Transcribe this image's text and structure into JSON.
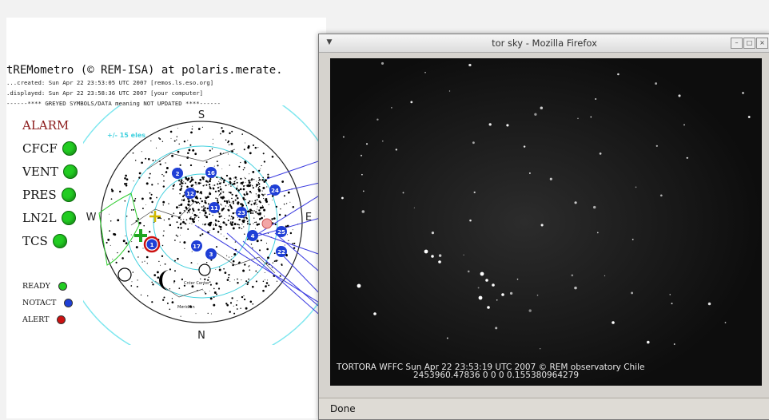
{
  "page": {
    "title": "tREMometro (© REM-ISA) at polaris.merate.",
    "info_lines": [
      "...created: Sun Apr 22 23:53:05 UTC 2007 [remos.ls.eso.org]",
      ".displayed: Sun Apr 22 23:58:36 UTC 2007 [your computer]",
      "------**** GREYED SYMBOLS/DATA meaning NOT UPDATED ****------"
    ],
    "alarm_label": "ALARM",
    "status_items": [
      {
        "label": "CFCF",
        "color": "#22cc22"
      },
      {
        "label": "VENT",
        "color": "#22cc22"
      },
      {
        "label": "PRES",
        "color": "#22cc22"
      },
      {
        "label": "LN2L",
        "color": "#22cc22"
      },
      {
        "label": "TCS",
        "color": "#22cc22"
      }
    ],
    "legend": [
      {
        "label": "READY",
        "color": "#22cc22"
      },
      {
        "label": "NOTACT",
        "color": "#1f3fd6"
      },
      {
        "label": "ALERT",
        "color": "#cc1111"
      }
    ]
  },
  "skymap": {
    "directions": {
      "north": "N",
      "south": "S",
      "east": "E",
      "west": "W"
    },
    "elevation_label": "+/- 15 eles",
    "target_markers": [
      "2",
      "16",
      "12",
      "24",
      "11",
      "23",
      "4",
      "25",
      "1",
      "17",
      "3",
      "22"
    ],
    "moon_labels": [
      "Cnter Center",
      "Meridian"
    ]
  },
  "browser": {
    "window_title": "tor sky - Mozilla Firefox",
    "menu_icon": "chevron-down-icon",
    "window_buttons": [
      "minimize-icon",
      "maximize-icon",
      "close-icon"
    ],
    "caption_line1": "TORTORA WFFC Sun Apr 22 23:53:19 UTC 2007 © REM observatory Chile",
    "caption_line2": "2453960.47836 0 0 0 0.155380964279",
    "status": "Done"
  },
  "colors": {
    "status_ok": "#22cc22",
    "marker_blue": "#1f3fd6",
    "sky_bg": "#121212"
  }
}
